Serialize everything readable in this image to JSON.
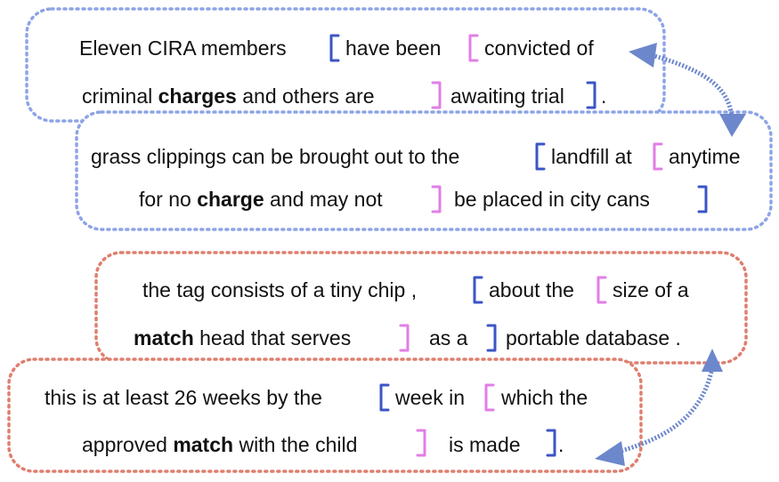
{
  "colors": {
    "blue_border": "#8ea4e6",
    "red_border": "#de7f6f",
    "blue_bracket": "#3b55c6",
    "pink_bracket": "#e27ee6",
    "arrow": "#6d87cc"
  },
  "examples": [
    {
      "group": "charge",
      "line1": [
        "Eleven CIRA members",
        "have been",
        "convicted of"
      ],
      "line2": {
        "pre": "criminal ",
        "bold": "charges",
        "post": " and others are",
        "mid": "awaiting trial",
        "end": "."
      }
    },
    {
      "group": "charge",
      "line1": [
        "grass clippings can be brought out to the",
        "landfill at",
        "anytime"
      ],
      "line2": {
        "pre": "for no ",
        "bold": "charge",
        "post": " and may not",
        "mid": "be placed in city cans",
        "end": ""
      }
    },
    {
      "group": "match",
      "line1": [
        "the tag consists of a tiny chip ,",
        "about the",
        "size of a"
      ],
      "line2": {
        "pre": "",
        "bold": "match",
        "post": " head that serves",
        "mid": "as a",
        "end": "portable database ."
      }
    },
    {
      "group": "match",
      "line1": [
        "this is at least 26 weeks by the",
        "week in",
        "which the"
      ],
      "line2": {
        "pre": "approved ",
        "bold": "match",
        "post": " with the child",
        "mid": "is made",
        "end": "."
      }
    }
  ]
}
